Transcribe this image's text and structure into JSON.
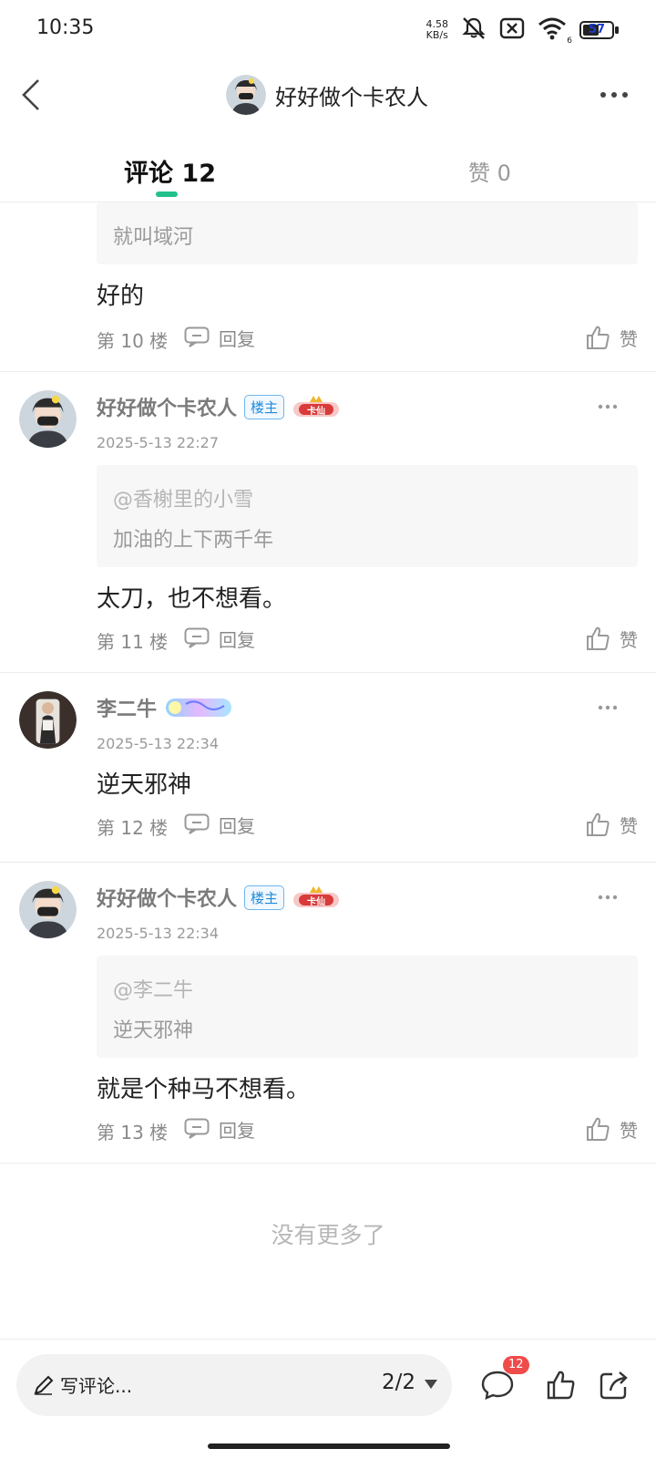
{
  "status_bar": {
    "time": "10:35",
    "net_speed_value": "4.58",
    "net_speed_unit": "KB/s",
    "signal_sub": "6",
    "battery_level": "57",
    "icons": [
      "mute-icon",
      "no-sim-icon",
      "wifi-icon",
      "battery-icon"
    ]
  },
  "header": {
    "title": "好好做个卡农人"
  },
  "tabs": {
    "comments_label": "评论",
    "comments_count": "12",
    "likes_label": "赞",
    "likes_count": "0",
    "accent_color": "#22c08a"
  },
  "comments": [
    {
      "quote_text": "就叫域河",
      "body": "好的",
      "floor": "第 10 楼",
      "reply_label": "回复",
      "like_label": "赞"
    },
    {
      "username": "好好做个卡农人",
      "op_badge": "楼主",
      "medal_text": "卡仙",
      "time": "2025-5-13 22:27",
      "quote_user": "@香榭里的小雪",
      "quote_text": "加油的上下两千年",
      "body": "太刀，也不想看。",
      "floor": "第 11 楼",
      "reply_label": "回复",
      "like_label": "赞"
    },
    {
      "username": "李二牛",
      "time": "2025-5-13 22:34",
      "body": "逆天邪神",
      "floor": "第 12 楼",
      "reply_label": "回复",
      "like_label": "赞"
    },
    {
      "username": "好好做个卡农人",
      "op_badge": "楼主",
      "medal_text": "卡仙",
      "time": "2025-5-13 22:34",
      "quote_user": "@李二牛",
      "quote_text": "逆天邪神",
      "body": "就是个种马不想看。",
      "floor": "第 13 楼",
      "reply_label": "回复",
      "like_label": "赞"
    }
  ],
  "footer_note": "没有更多了",
  "bottom_bar": {
    "input_placeholder": "写评论...",
    "page_indicator": "2/2",
    "comment_badge_count": "12",
    "badge_color": "#f04b4b"
  }
}
